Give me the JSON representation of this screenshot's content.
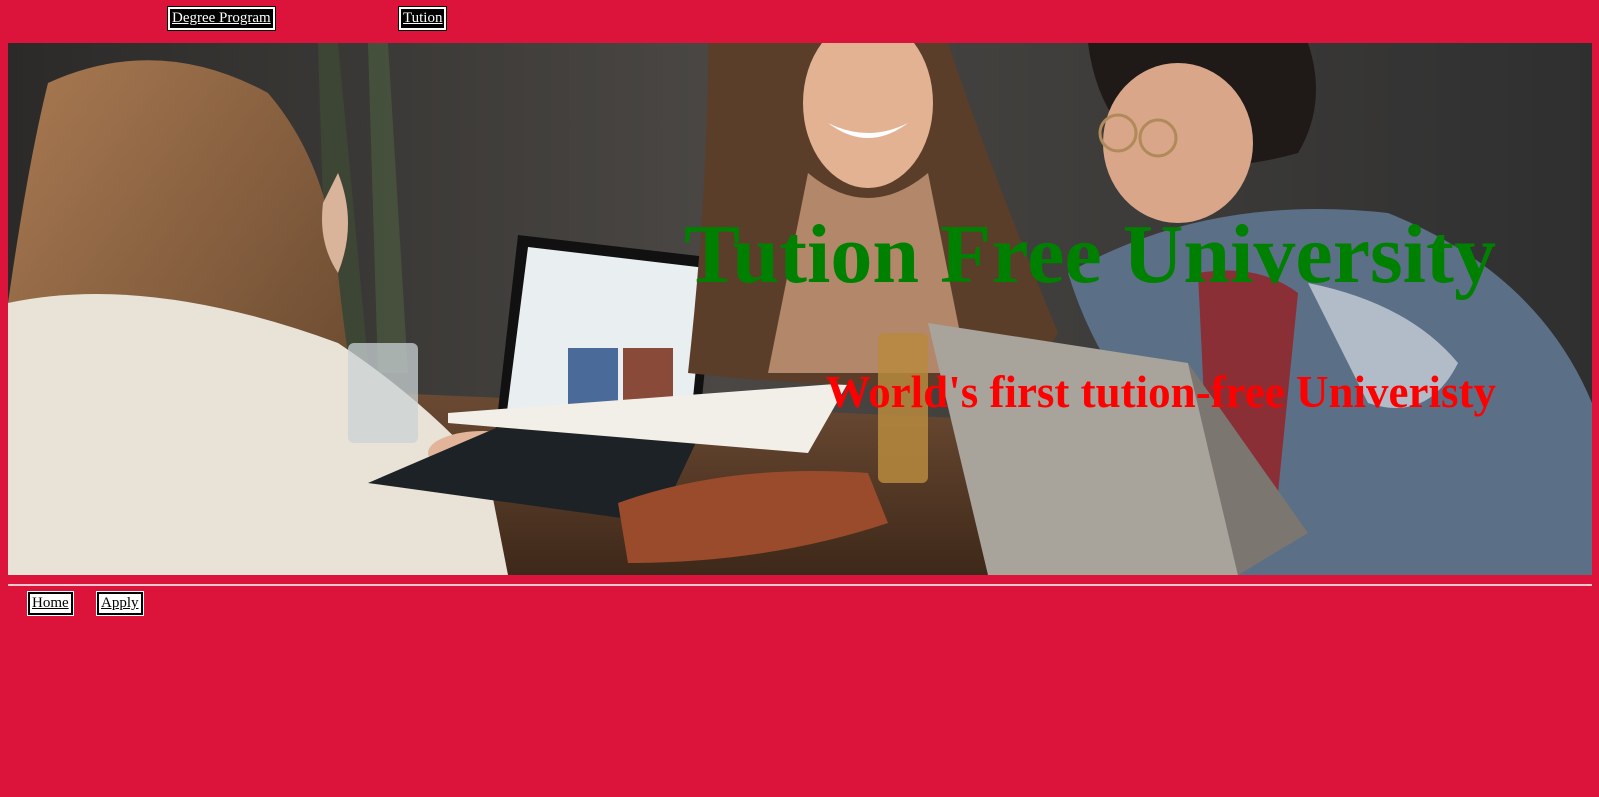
{
  "top_nav": {
    "items": [
      {
        "label": "Degree Program"
      },
      {
        "label": "Tution"
      }
    ]
  },
  "hero": {
    "title": "Tution Free University",
    "subtitle": "World's first tution-free Univeristy",
    "image_semantic": "three-students-laughing-around-table-with-laptops-photo"
  },
  "footer_nav": {
    "items": [
      {
        "label": "Home"
      },
      {
        "label": "Apply"
      }
    ]
  },
  "colors": {
    "page_background": "#dc143c",
    "title": "#008000",
    "subtitle": "#ff0000"
  }
}
